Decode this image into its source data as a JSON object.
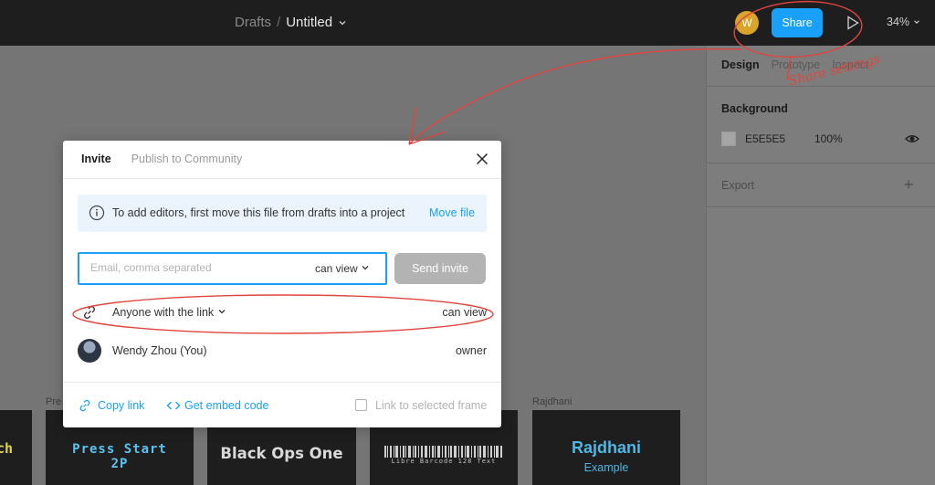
{
  "topbar": {
    "breadcrumb_parent": "Drafts",
    "breadcrumb_separator": "/",
    "file_name": "Untitled",
    "avatar_initial": "W",
    "share_label": "Share",
    "zoom_label": "34%",
    "icons": [
      "chevron-down-icon",
      "play-icon",
      "zoom-chevron-icon"
    ]
  },
  "right_panel": {
    "tabs": [
      {
        "label": "Design",
        "active": true
      },
      {
        "label": "Prototype",
        "active": false
      },
      {
        "label": "Inspect",
        "active": false
      }
    ],
    "background_title": "Background",
    "background_hex": "E5E5E5",
    "background_opacity": "100%",
    "export_title": "Export",
    "icons": [
      "eye-icon",
      "plus-icon"
    ]
  },
  "modal": {
    "tabs": [
      {
        "label": "Invite",
        "active": true
      },
      {
        "label": "Publish to Community",
        "active": false
      }
    ],
    "notice_text": "To add editors, first move this file from drafts into a project",
    "notice_action": "Move file",
    "email_placeholder": "Email, comma separated",
    "email_permission": "can view",
    "send_label": "Send invite",
    "link_access_label": "Anyone with the link",
    "link_access_permission": "can view",
    "user_name": "Wendy Zhou (You)",
    "user_role": "owner",
    "copy_link_label": "Copy link",
    "embed_label": "Get embed code",
    "frame_checkbox_label": "Link to selected frame",
    "frame_checkbox_checked": false
  },
  "canvas": {
    "card_labels": [
      "Pre",
      "Rajdhani"
    ],
    "card_texts": {
      "card_1": "ch",
      "card_2_line1": "Press Start",
      "card_2_line2": "2P",
      "card_3": "Black Ops One",
      "card_4": "Libre Barcode 128 Text",
      "card_5_title": "Rajdhani",
      "card_5_sub": "Example"
    }
  },
  "annotations": {
    "note": "Share settings",
    "color": "#e0453f"
  },
  "colors": {
    "accent": "#18a0fb",
    "topbar_bg": "#1e1e1e",
    "canvas_bg": "#757575"
  }
}
